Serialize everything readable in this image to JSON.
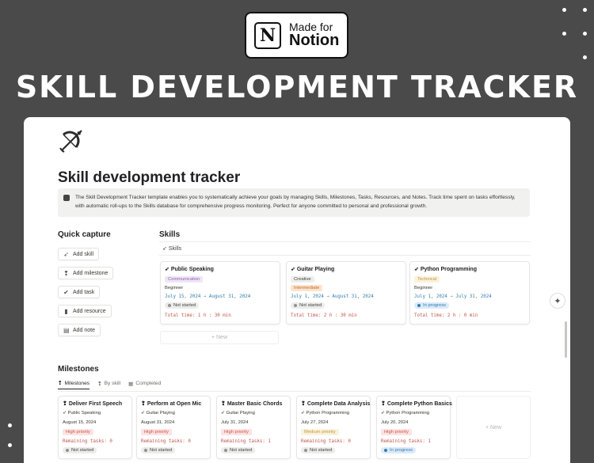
{
  "badge": {
    "line1": "Made for",
    "line2": "Notion",
    "logo_letter": "N"
  },
  "hero_title": "SKILL DEVELOPMENT TRACKER",
  "page": {
    "title": "Skill development tracker",
    "icon": "bow-and-arrow-icon",
    "callout": "The Skill Development Tracker template enables you to systematically achieve your goals by managing Skills, Milestones, Tasks, Resources, and Notes. Track time spent on tasks effortlessly, with automatic roll-ups to the Skills database for comprehensive progress monitoring. Perfect for anyone committed to personal and professional growth."
  },
  "quick_capture": {
    "heading": "Quick capture",
    "buttons": [
      {
        "label": "Add skill",
        "icon": "bow-icon",
        "glyph": "➶"
      },
      {
        "label": "Add milestone",
        "icon": "pin-icon",
        "glyph": "❢"
      },
      {
        "label": "Add task",
        "icon": "check-circle-icon",
        "glyph": "✔"
      },
      {
        "label": "Add resource",
        "icon": "bookmark-icon",
        "glyph": "▮"
      },
      {
        "label": "Add note",
        "icon": "note-icon",
        "glyph": "▤"
      }
    ]
  },
  "skills": {
    "heading": "Skills",
    "view_label": "Skills",
    "new_label": "+ New",
    "cards": [
      {
        "title": "Public Speaking",
        "category": "Communication",
        "level": "Beginner",
        "dates": "July 15, 2024 → August 31, 2024",
        "status": "Not started",
        "time": "Total time: 1 h : 30 min"
      },
      {
        "title": "Guitar Playing",
        "category": "Creative",
        "level": "Intermediate",
        "dates": "July 1, 2024 → August 31, 2024",
        "status": "Not started",
        "time": "Total time: 2 h : 30 min"
      },
      {
        "title": "Python Programming",
        "category": "Technical",
        "level": "Beginner",
        "dates": "July 1, 2024 → July 31, 2024",
        "status": "In progress",
        "time": "Total time: 2 h : 0 min"
      }
    ]
  },
  "milestones": {
    "heading": "Milestones",
    "tabs": [
      {
        "label": "Milestones",
        "glyph": "❢"
      },
      {
        "label": "By skill",
        "glyph": "❢"
      },
      {
        "label": "Completed",
        "glyph": "▦"
      }
    ],
    "new_label": "+ New",
    "cards": [
      {
        "title": "Deliver First Speech",
        "skill": "Public Speaking",
        "date": "August 15, 2024",
        "priority": "High priority",
        "remaining": "Remaining tasks: 0",
        "status": "Not started"
      },
      {
        "title": "Perform at Open Mic",
        "skill": "Guitar Playing",
        "date": "August 31, 2024",
        "priority": "High priority",
        "remaining": "Remaining tasks: 0",
        "status": "Not started"
      },
      {
        "title": "Master Basic Chords",
        "skill": "Guitar Playing",
        "date": "July 31, 2024",
        "priority": "High priority",
        "remaining": "Remaining tasks: 1",
        "status": "Not started"
      },
      {
        "title": "Complete Data Analysis",
        "skill": "Python Programming",
        "date": "July 27, 2024",
        "priority": "Medium priority",
        "remaining": "Remaining tasks: 0",
        "status": "Not started"
      },
      {
        "title": "Complete Python Basics",
        "skill": "Python Programming",
        "date": "July 20, 2024",
        "priority": "High priority",
        "remaining": "Remaining tasks: 1",
        "status": "In progress"
      }
    ]
  },
  "colors": {
    "communication_bg": "#f0e6f7",
    "communication_fg": "#9065b0",
    "creative_bg": "#eeeeed",
    "creative_fg": "#444",
    "intermediate_bg": "#fbe4cf",
    "intermediate_fg": "#c86a1e",
    "technical_bg": "#fbf3db",
    "technical_fg": "#c29343",
    "high_bg": "#fde3e2",
    "high_fg": "#c4554d",
    "medium_bg": "#fbf3db",
    "medium_fg": "#c29343",
    "notstarted_bg": "#ececeb",
    "inprogress_bg": "#dbeafa",
    "inprogress_dot": "#337ea9",
    "notstarted_dot": "#91918e"
  }
}
